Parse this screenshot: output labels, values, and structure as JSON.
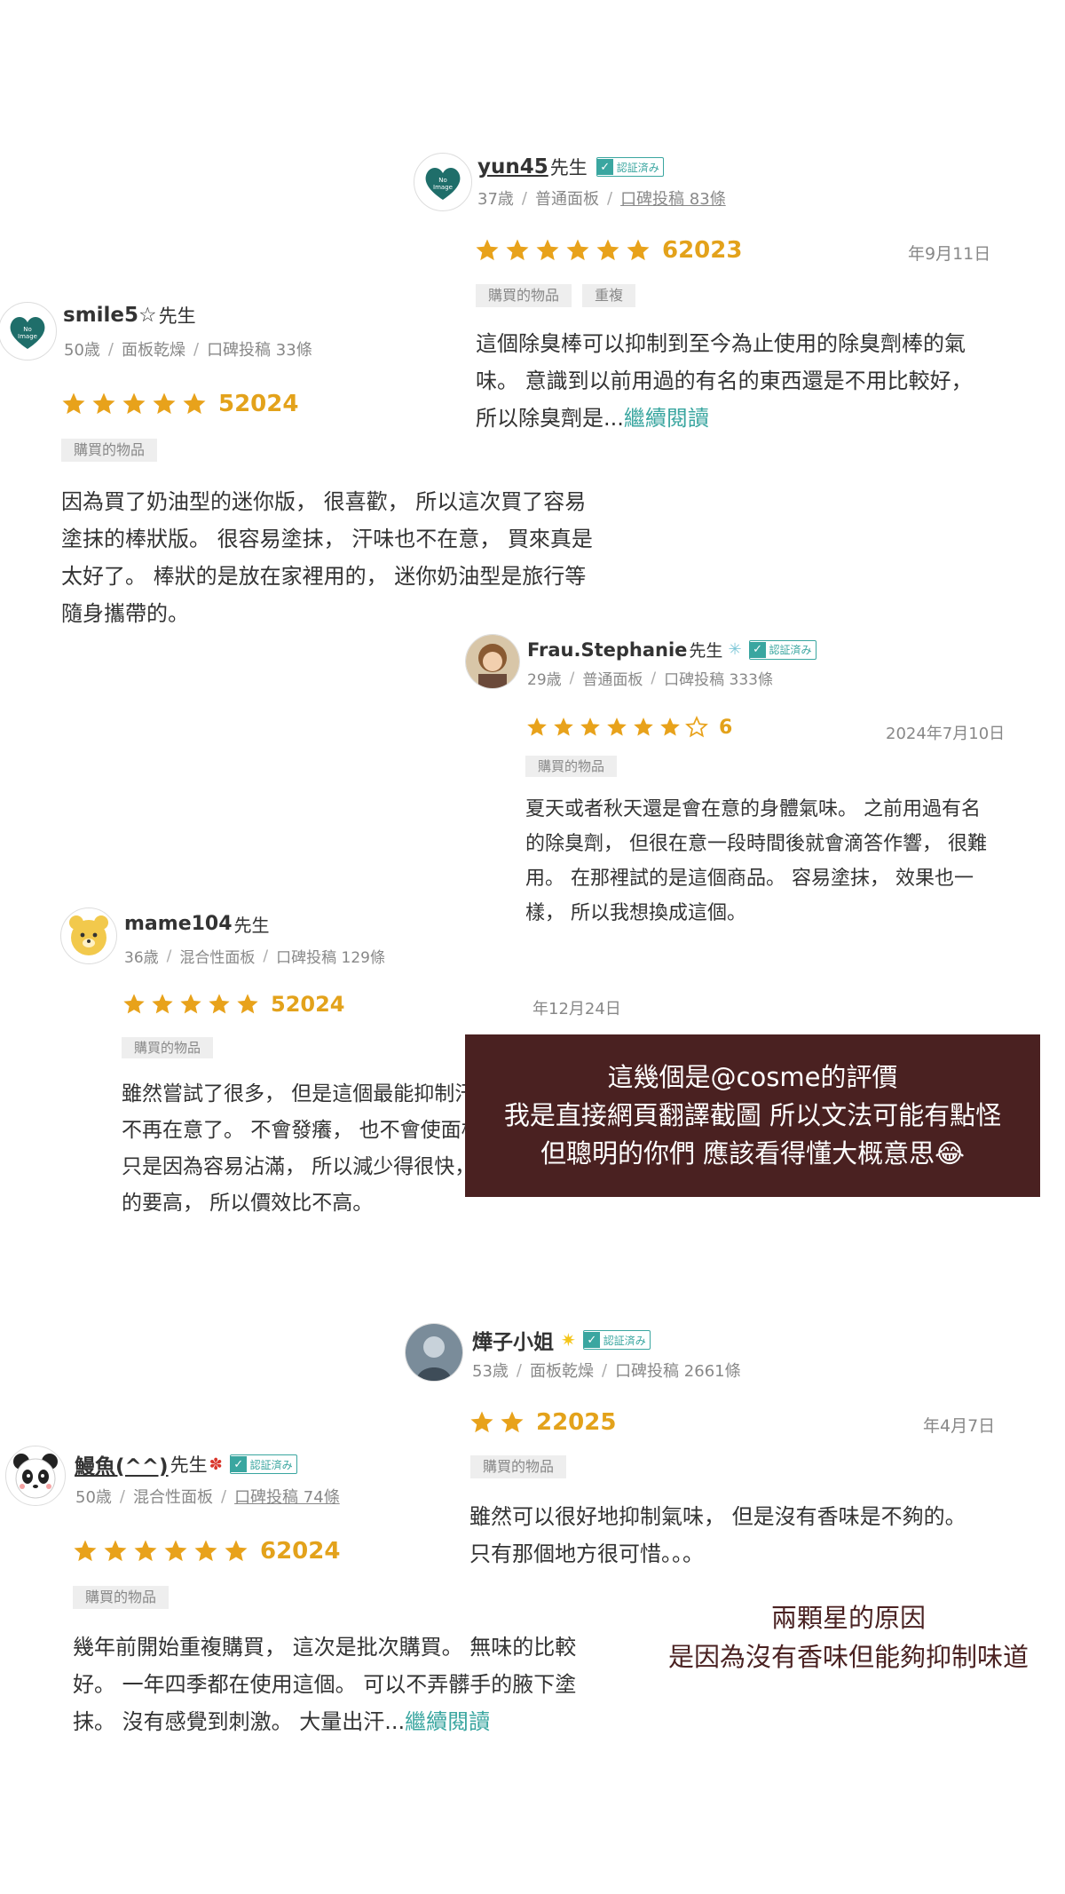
{
  "colors": {
    "star": "#e8a21b",
    "link": "#3aa6a0",
    "banner_bg": "#4a2121"
  },
  "reviews": [
    {
      "username": "yun45",
      "suffix": "先生",
      "verified": "認証済み",
      "age": "37歳",
      "skin": "普通面板",
      "posts": "口碑投稿 83條",
      "stars": 6,
      "rating": "62023",
      "date": "年9月11日",
      "tags": [
        "購買的物品",
        "重複"
      ],
      "text": "這個除臭棒可以抑制到至今為止使用的除臭劑棒的氣味。 意識到以前用過的有名的東西還是不用比較好， 所以除臭劑是...",
      "more": "繼續閱讀",
      "avatar_icon": "no-image-heart-icon"
    },
    {
      "username": "smile5☆",
      "suffix": "先生",
      "age": "50歳",
      "skin": "面板乾燥",
      "posts": "口碑投稿 33條",
      "stars": 5,
      "rating": "52024",
      "tags": [
        "購買的物品"
      ],
      "text": "因為買了奶油型的迷你版， 很喜歡， 所以這次買了容易塗抹的棒狀版。 很容易塗抹， 汗味也不在意， 買來真是太好了。 棒狀的是放在家裡用的， 迷你奶油型是旅行等隨身攜帶的。",
      "avatar_icon": "no-image-heart-icon"
    },
    {
      "username": "Frau.Stephanie",
      "suffix": "先生",
      "verified": "認証済み",
      "age": "29歳",
      "skin": "普通面板",
      "posts": "口碑投稿 333條",
      "stars": 6,
      "stars_total": 7,
      "rating": "6",
      "date": "2024年7月10日",
      "tags": [
        "購買的物品"
      ],
      "text": "夏天或者秋天還是會在意的身體氣味。 之前用過有名的除臭劑， 但很在意一段時間後就會滴答作響， 很難用。 在那裡試的是這個商品。 容易塗抹， 效果也一樣， 所以我想換成這個。",
      "avatar_icon": "profile-photo"
    },
    {
      "username": "mame104",
      "suffix": "先生",
      "age": "36歳",
      "skin": "混合性面板",
      "posts": "口碑投稿 129條",
      "stars": 5,
      "rating": "52024",
      "date": "年12月24日",
      "tags": [
        "購買的物品"
      ],
      "text": "雖然嘗試了很多， 但是這個最能抑制汗水， 氣味也不再在意了。 不會發癢， 也不會使面板變得粗糙。 只是因為容易沾滿， 所以減少得很快， 價格比其他的要高， 所以價效比不高。",
      "avatar_icon": "bear-icon"
    },
    {
      "username": "燁子小姐",
      "suffix": "",
      "verified": "認証済み",
      "age": "53歳",
      "skin": "面板乾燥",
      "posts": "口碑投稿 2661條",
      "stars": 2,
      "rating": "22025",
      "date": "年4月7日",
      "tags": [
        "購買的物品"
      ],
      "text": "雖然可以很好地抑制氣味， 但是沒有香味是不夠的。 只有那個地方很可惜。。。",
      "avatar_icon": "profile-photo"
    },
    {
      "username": "鰻魚(^^)",
      "suffix": "先生",
      "verified": "認証済み",
      "age": "50歳",
      "skin": "混合性面板",
      "posts": "口碑投稿 74條",
      "stars": 6,
      "rating": "62024",
      "tags": [
        "購買的物品"
      ],
      "text": "幾年前開始重複購買， 這次是批次購買。 無味的比較好。 一年四季都在使用這個。 可以不弄髒手的腋下塗抹。 沒有感覺到刺激。 大量出汗...",
      "more": "繼續閱讀",
      "avatar_icon": "panda-icon"
    }
  ],
  "banner": {
    "line1": "這幾個是@cosme的評價",
    "line2": "我是直接網頁翻譯截圖 所以文法可能有點怪",
    "line3": "但聰明的你們 應該看得懂大概意思😂"
  },
  "note": {
    "line1": "兩顆星的原因",
    "line2": "是因為沒有香味但能夠抑制味道"
  }
}
